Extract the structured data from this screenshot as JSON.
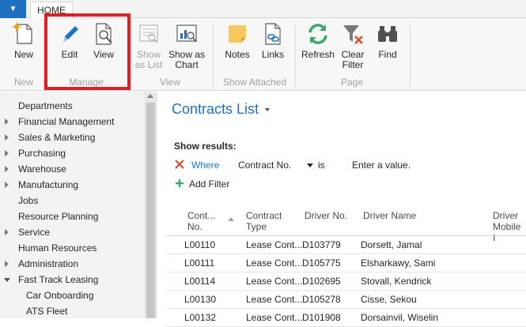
{
  "tabs": {
    "home": "HOME"
  },
  "ribbon": {
    "buttons": {
      "new": "New",
      "edit": "Edit",
      "view": "View",
      "show_as_list": "Show\nas List",
      "show_as_chart": "Show as\nChart",
      "notes": "Notes",
      "links": "Links",
      "refresh": "Refresh",
      "clear_filter": "Clear\nFilter",
      "find": "Find"
    },
    "groups": {
      "new": "New",
      "manage": "Manage",
      "view": "View",
      "show_attached": "Show Attached",
      "page": "Page"
    }
  },
  "nav": {
    "items": [
      {
        "label": "Departments",
        "expander": "none"
      },
      {
        "label": "Financial Management",
        "expander": "collapsed"
      },
      {
        "label": "Sales & Marketing",
        "expander": "collapsed"
      },
      {
        "label": "Purchasing",
        "expander": "collapsed"
      },
      {
        "label": "Warehouse",
        "expander": "collapsed"
      },
      {
        "label": "Manufacturing",
        "expander": "collapsed"
      },
      {
        "label": "Jobs",
        "expander": "none"
      },
      {
        "label": "Resource Planning",
        "expander": "none"
      },
      {
        "label": "Service",
        "expander": "collapsed"
      },
      {
        "label": "Human Resources",
        "expander": "none"
      },
      {
        "label": "Administration",
        "expander": "collapsed"
      },
      {
        "label": "Fast Track Leasing",
        "expander": "expanded"
      },
      {
        "label": "Car Onboarding",
        "expander": "child"
      },
      {
        "label": "ATS Fleet",
        "expander": "child"
      }
    ]
  },
  "main": {
    "title": "Contracts List",
    "show_results": "Show results:",
    "filter": {
      "where": "Where",
      "field": "Contract No.",
      "operator": "is",
      "value_placeholder": "Enter a value."
    },
    "add_filter": "Add Filter"
  },
  "table": {
    "columns": [
      "Cont...\nNo.",
      "Contract\nType",
      "Driver No.",
      "Driver Name",
      "Driver\nMobile I"
    ],
    "rows": [
      [
        "L00110",
        "Lease Cont...",
        "D103779",
        "Dorsett, Jamal"
      ],
      [
        "L00111",
        "Lease Cont...",
        "D105775",
        "Elsharkawy, Sami"
      ],
      [
        "L00114",
        "Lease Cont...",
        "D102695",
        "Stovall, Kendrick"
      ],
      [
        "L00130",
        "Lease Cont...",
        "D105278",
        "Cisse, Sekou"
      ],
      [
        "L00132",
        "Lease Cont...",
        "D101908",
        "Dorsainvil, Wiselin"
      ]
    ]
  },
  "colors": {
    "accent": "#1f70c1",
    "highlight": "#e01e26",
    "nav_bg": "#f3f3f3"
  }
}
